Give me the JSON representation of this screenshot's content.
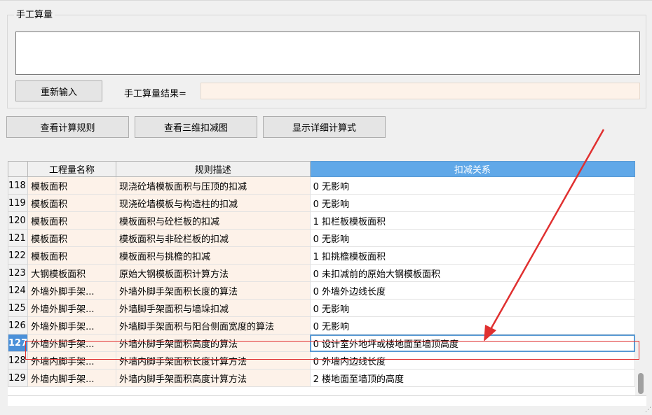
{
  "manual": {
    "title": "手工算量",
    "reset_label": "重新输入",
    "result_label": "手工算量结果=",
    "result_value": ""
  },
  "toolbar": {
    "rules_label": "查看计算规则",
    "view3d_label": "查看三维扣减图",
    "detail_label": "显示详细计算式"
  },
  "table": {
    "headers": [
      "工程量名称",
      "规则描述",
      "扣减关系"
    ],
    "rows": [
      {
        "num": "118",
        "name": "模板面积",
        "desc": "现浇砼墙模板面积与压顶的扣减",
        "rel": "0  无影响"
      },
      {
        "num": "119",
        "name": "模板面积",
        "desc": "现浇砼墙模板与构造柱的扣减",
        "rel": "0  无影响"
      },
      {
        "num": "120",
        "name": "模板面积",
        "desc": "模板面积与砼栏板的扣减",
        "rel": "1 扣栏板模板面积"
      },
      {
        "num": "121",
        "name": "模板面积",
        "desc": "模板面积与非砼栏板的扣减",
        "rel": "0  无影响"
      },
      {
        "num": "122",
        "name": "模板面积",
        "desc": "模板面积与挑檐的扣减",
        "rel": "1 扣挑檐模板面积"
      },
      {
        "num": "123",
        "name": "大钢模板面积",
        "desc": "原始大钢模板面积计算方法",
        "rel": "0 未扣减前的原始大钢模板面积"
      },
      {
        "num": "124",
        "name": "外墙外脚手架...",
        "desc": "外墙外脚手架面积长度的算法",
        "rel": "0  外墙外边线长度"
      },
      {
        "num": "125",
        "name": "外墙外脚手架...",
        "desc": "外墙脚手架面积与墙垛扣减",
        "rel": "0  无影响"
      },
      {
        "num": "126",
        "name": "外墙外脚手架...",
        "desc": "外墙脚手架面积与阳台侧面宽度的算法",
        "rel": "0  无影响"
      },
      {
        "num": "127",
        "name": "外墙外脚手架...",
        "desc": "外墙外脚手架面积高度的算法",
        "rel": "0 设计室外地坪或楼地面至墙顶高度"
      },
      {
        "num": "128",
        "name": "外墙内脚手架...",
        "desc": "外墙内脚手架面积长度计算方法",
        "rel": "0  外墙内边线长度"
      },
      {
        "num": "129",
        "name": "外墙内脚手架...",
        "desc": "外墙内脚手架面积高度计算方法",
        "rel": "2 楼地面至墙顶的高度"
      }
    ],
    "selected_row": "127"
  },
  "colors": {
    "header_active": "#60a8e8",
    "row_tint": "#fdf2e9",
    "annotation_red": "#e03030"
  }
}
